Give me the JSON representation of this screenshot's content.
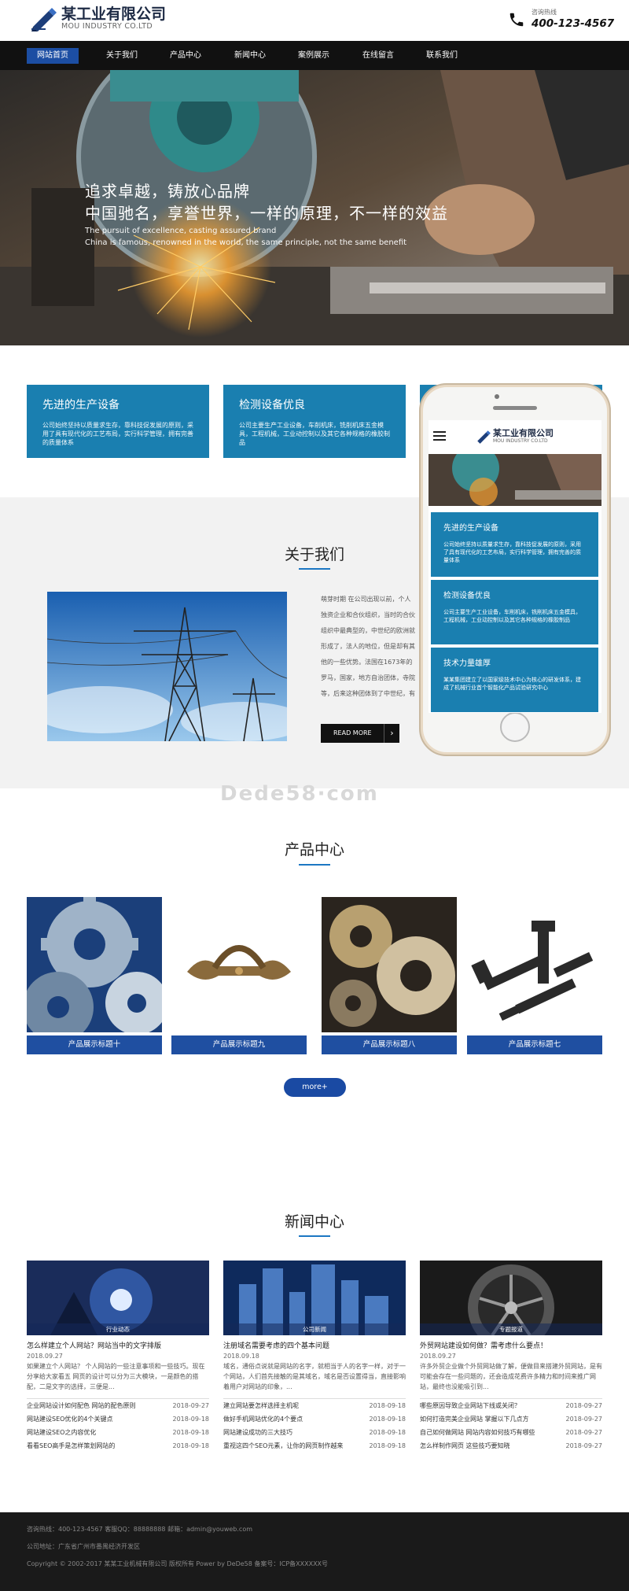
{
  "header": {
    "company_name": "某工业有限公司",
    "company_name_en": "MOU INDUSTRY CO.LTD",
    "phone_caption": "咨询热线",
    "phone_number": "400-123-4567"
  },
  "nav": {
    "items": [
      {
        "label": "网站首页",
        "active": true
      },
      {
        "label": "关于我们",
        "active": false
      },
      {
        "label": "产品中心",
        "active": false
      },
      {
        "label": "新闻中心",
        "active": false
      },
      {
        "label": "案例展示",
        "active": false
      },
      {
        "label": "在线留言",
        "active": false
      },
      {
        "label": "联系我们",
        "active": false
      }
    ]
  },
  "banner": {
    "line1": "追求卓越，铸放心品牌",
    "line2": "中国驰名，享誉世界，一样的原理，不一样的效益",
    "en1": "The pursuit of excellence, casting assured brand",
    "en2": "China is famous, renowned in the world, the same principle, not the same benefit"
  },
  "features": [
    {
      "title": "先进的生产设备",
      "desc": "公司始终坚持以质量求生存，靠科技促发展的原则，采用了具有现代化的工艺布局，实行科学管理，拥有完善的质量体系"
    },
    {
      "title": "检测设备优良",
      "desc": "公司主要生产工业设备，车削机床，铣削机床五金模具，工程机械，工业动控制以及其它各种规格的橡胶制品"
    }
  ],
  "about": {
    "title": "关于我们",
    "text": "萌芽时期 在公司出现以前，个人独资企业和合伙组织，当时的合伙组织中最典型的，中世纪的欧洲就形成了，法人的地位，但是却有其他的一些优势。法国在1673年的罗马，国家，地方自治团体，寺院等，后来这种团体到了中世纪，有一些贸易团体取得了法人资格。在英国，这样的组织享有相同的合伙组织的特权，无限公司与合伙没有本质上的区别",
    "read_more": "READ MORE",
    "arrow": "›"
  },
  "mobile_preview": {
    "company_name": "某工业有限公司",
    "company_name_en": "MOU INDUSTRY CO.LTD",
    "features": [
      {
        "title": "先进的生产设备",
        "desc": "公司始终坚持以质量求生存，靠科技促发展的原则，采用了具有现代化的工艺布局，实行科学管理，拥有完善的质量体系"
      },
      {
        "title": "检测设备优良",
        "desc": "公司主要生产工业设备，车削机床，铣削机床五金模具，工程机械，工业动控制以及其它各种规格的橡胶制品"
      },
      {
        "title": "技术力量雄厚",
        "desc": "某某集团建立了以国家级技术中心为核心的研发体系，建成了机械行业首个智能化产品试验研究中心"
      }
    ]
  },
  "watermark": "Dede58·com",
  "products": {
    "title": "产品中心",
    "items": [
      {
        "label": "产品展示标题十"
      },
      {
        "label": "产品展示标题九"
      },
      {
        "label": "产品展示标题八"
      },
      {
        "label": "产品展示标题七"
      }
    ],
    "more": "more+"
  },
  "news": {
    "title": "新闻中心",
    "columns": [
      {
        "category": "行业动态",
        "headline": "怎么样建立个人网站？网站当中的文字排版",
        "date": "2018.09.27",
        "desc": "如果建立个人网站？ 个人网站的一些注意事项和一些技巧。现在分享给大家看五 网页的设计可以分为三大模块，一是颜色的搭配，二是文字的选择，三便是...",
        "list": [
          {
            "title": "企业网站设计如何配色 网站的配色原则",
            "date": "2018-09-27"
          },
          {
            "title": "网站建设SEO优化的4个关键点",
            "date": "2018-09-18"
          },
          {
            "title": "网站建设SEO之内容优化",
            "date": "2018-09-18"
          },
          {
            "title": "看看SEO高手是怎样策划网站的",
            "date": "2018-09-18"
          }
        ]
      },
      {
        "category": "公司新闻",
        "headline": "注册域名需要考虑的四个基本问题",
        "date": "2018.09.18",
        "desc": "域名，通俗点说就是网站的名字，就相当于人的名字一样，对于一个网站，人们首先接触的是其域名，域名是否设置得当，直接影响着用户对网站的印象，...",
        "list": [
          {
            "title": "建立网站要怎样选择主机呢",
            "date": "2018-09-18"
          },
          {
            "title": "做好手机网站优化的4个要点",
            "date": "2018-09-18"
          },
          {
            "title": "网站建设成功的三大技巧",
            "date": "2018-09-18"
          },
          {
            "title": "重视这四个SEO元素，让你的网页制作越来",
            "date": "2018-09-18"
          }
        ]
      },
      {
        "category": "专题报道",
        "headline": "外贸网站建设如何做？需考虑什么要点！",
        "date": "2018.09.27",
        "desc": "许多外贸企业做个外贸网站做了解，便做目来搭建外贸网站，是有可能会存在一些问题的，还会造成花费许多精力和时间来推广网站，最终也没能吸引到...",
        "list": [
          {
            "title": "哪些原因导致企业网站下线或关闭？",
            "date": "2018-09-27"
          },
          {
            "title": "如何打造完美企业网站 掌握以下几点方",
            "date": "2018-09-27"
          },
          {
            "title": "自己如何做网站 网站内容如何技巧有哪些",
            "date": "2018-09-27"
          },
          {
            "title": "怎么样制作网页 这些技巧要知晓",
            "date": "2018-09-27"
          }
        ]
      }
    ]
  },
  "footer": {
    "line1": "咨询热线：400-123-4567    客服QQ：88888888    邮箱：admin@youweb.com",
    "line2": "公司地址：广东省广州市番禺经济开发区",
    "line3": "Copyright © 2002-2017 某某工业机械有限公司 版权所有 Power by DeDe58  备案号：ICP备XXXXXX号"
  },
  "colors": {
    "nav_bg": "#111111",
    "nav_active": "#1c4ea3",
    "feature_blue": "#1a7fb0",
    "product_label": "#1f4fa1",
    "footer_bg": "#1a1a1a"
  }
}
